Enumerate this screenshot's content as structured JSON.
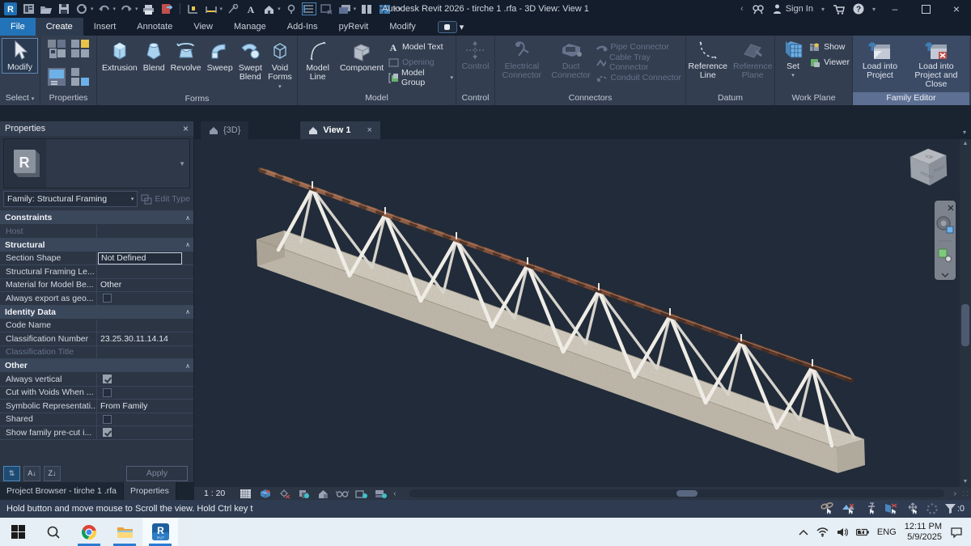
{
  "title_bar": {
    "title": "Autodesk Revit 2026 - tirche 1 .rfa - 3D View: View 1",
    "sign_in": "Sign In"
  },
  "tabs": [
    "File",
    "Create",
    "Insert",
    "Annotate",
    "View",
    "Manage",
    "Add-Ins",
    "pyRevit",
    "Modify"
  ],
  "ribbon": {
    "select": {
      "button": "Modify",
      "label": "Select"
    },
    "properties": {
      "label": "Properties"
    },
    "forms": {
      "label": "Forms",
      "items": [
        "Extrusion",
        "Blend",
        "Revolve",
        "Sweep",
        "Swept Blend",
        "Void Forms"
      ]
    },
    "model": {
      "label": "Model",
      "big": [
        "Model Line",
        "Component"
      ],
      "small": [
        "Model Text",
        "Opening",
        "Model Group"
      ]
    },
    "control": {
      "label": "Control",
      "item": "Control"
    },
    "connectors": {
      "label": "Connectors",
      "big": [
        "Electrical Connector",
        "Duct Connector"
      ],
      "small": [
        "Pipe Connector",
        "Cable Tray Connector",
        "Conduit Connector"
      ]
    },
    "datum": {
      "label": "Datum",
      "items": [
        "Reference Line",
        "Reference Plane"
      ]
    },
    "workplane": {
      "label": "Work Plane",
      "items": [
        "Set",
        "Show",
        "Viewer"
      ]
    },
    "family_editor": {
      "label": "Family Editor",
      "items": [
        "Load into Project",
        "Load into Project and Close"
      ]
    }
  },
  "properties_palette": {
    "header": "Properties",
    "type_family": "Family: Structural Framing",
    "edit_type": "Edit Type",
    "sections": [
      {
        "name": "Constraints",
        "rows": [
          {
            "label": "Host",
            "value": "",
            "disabled": true
          }
        ]
      },
      {
        "name": "Structural",
        "rows": [
          {
            "label": "Section Shape",
            "value": "Not Defined",
            "selected": true
          },
          {
            "label": "Structural Framing Le...",
            "value": ""
          },
          {
            "label": "Material for Model Be...",
            "value": "Other"
          },
          {
            "label": "Always export as geo...",
            "checkbox": false
          }
        ]
      },
      {
        "name": "Identity Data",
        "rows": [
          {
            "label": "Code Name",
            "value": ""
          },
          {
            "label": "Classification Number",
            "value": "23.25.30.11.14.14"
          },
          {
            "label": "Classification Title",
            "value": "",
            "disabled": true
          }
        ]
      },
      {
        "name": "Other",
        "rows": [
          {
            "label": "Always vertical",
            "checkbox": true
          },
          {
            "label": "Cut with Voids When ...",
            "checkbox": false
          },
          {
            "label": "Symbolic Representati...",
            "value": "From Family"
          },
          {
            "label": "Shared",
            "checkbox": false
          },
          {
            "label": "Show family pre-cut i...",
            "checkbox": true
          }
        ]
      }
    ],
    "apply": "Apply",
    "bottom_tabs": [
      "Project Browser - tirche 1 .rfa",
      "Properties"
    ]
  },
  "view_tabs": [
    {
      "label": "{3D}",
      "active": false
    },
    {
      "label": "View 1",
      "active": true
    }
  ],
  "view_control_bar": {
    "scale": "1 : 20"
  },
  "status_bar": {
    "message": "Hold button and move mouse to Scroll the view. Hold Ctrl key t",
    "filter_count": ":0"
  },
  "taskbar": {
    "language": "ENG",
    "time": "12:11 PM",
    "date": "5/9/2025"
  },
  "icons": {
    "dropdown": "▾",
    "close": "×",
    "minimize": "–",
    "collapse_section": "∧∧",
    "scroll_left": "‹",
    "scroll_right": "›"
  },
  "colors": {
    "accent_blue": "#2373b8",
    "taskbar_underline": "#2b7cd3",
    "canvas": "#212b39",
    "concrete": "#cfc9bc",
    "chord_rust": "#7b4c38",
    "web_white": "#eeebe5"
  }
}
